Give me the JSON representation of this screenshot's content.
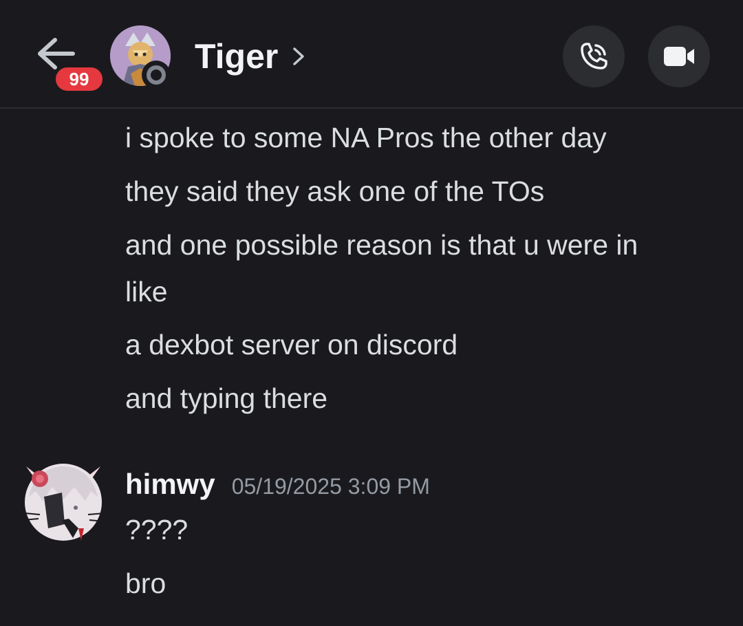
{
  "header": {
    "unread_count": "99",
    "contact_name": "Tiger",
    "icons": {
      "back": "arrow-left-icon",
      "chevron": "chevron-right-icon",
      "call": "phone-call-icon",
      "video": "video-camera-icon"
    },
    "status": "offline"
  },
  "messages": {
    "previous_group": {
      "lines": [
        "i spoke to some NA Pros the other day",
        "they said they ask one of the TOs",
        "and one possible reason is that u were in",
        "like",
        "a dexbot server on discord",
        "and typing there"
      ]
    },
    "current_group": {
      "author": "himwy",
      "timestamp": "05/19/2025 3:09 PM",
      "lines": [
        "????",
        "bro"
      ]
    }
  },
  "colors": {
    "background": "#1a1a1e",
    "badge": "#e5383f",
    "text": "#dbdee1",
    "muted": "#949ba4",
    "button_bg": "#2b2d31"
  }
}
